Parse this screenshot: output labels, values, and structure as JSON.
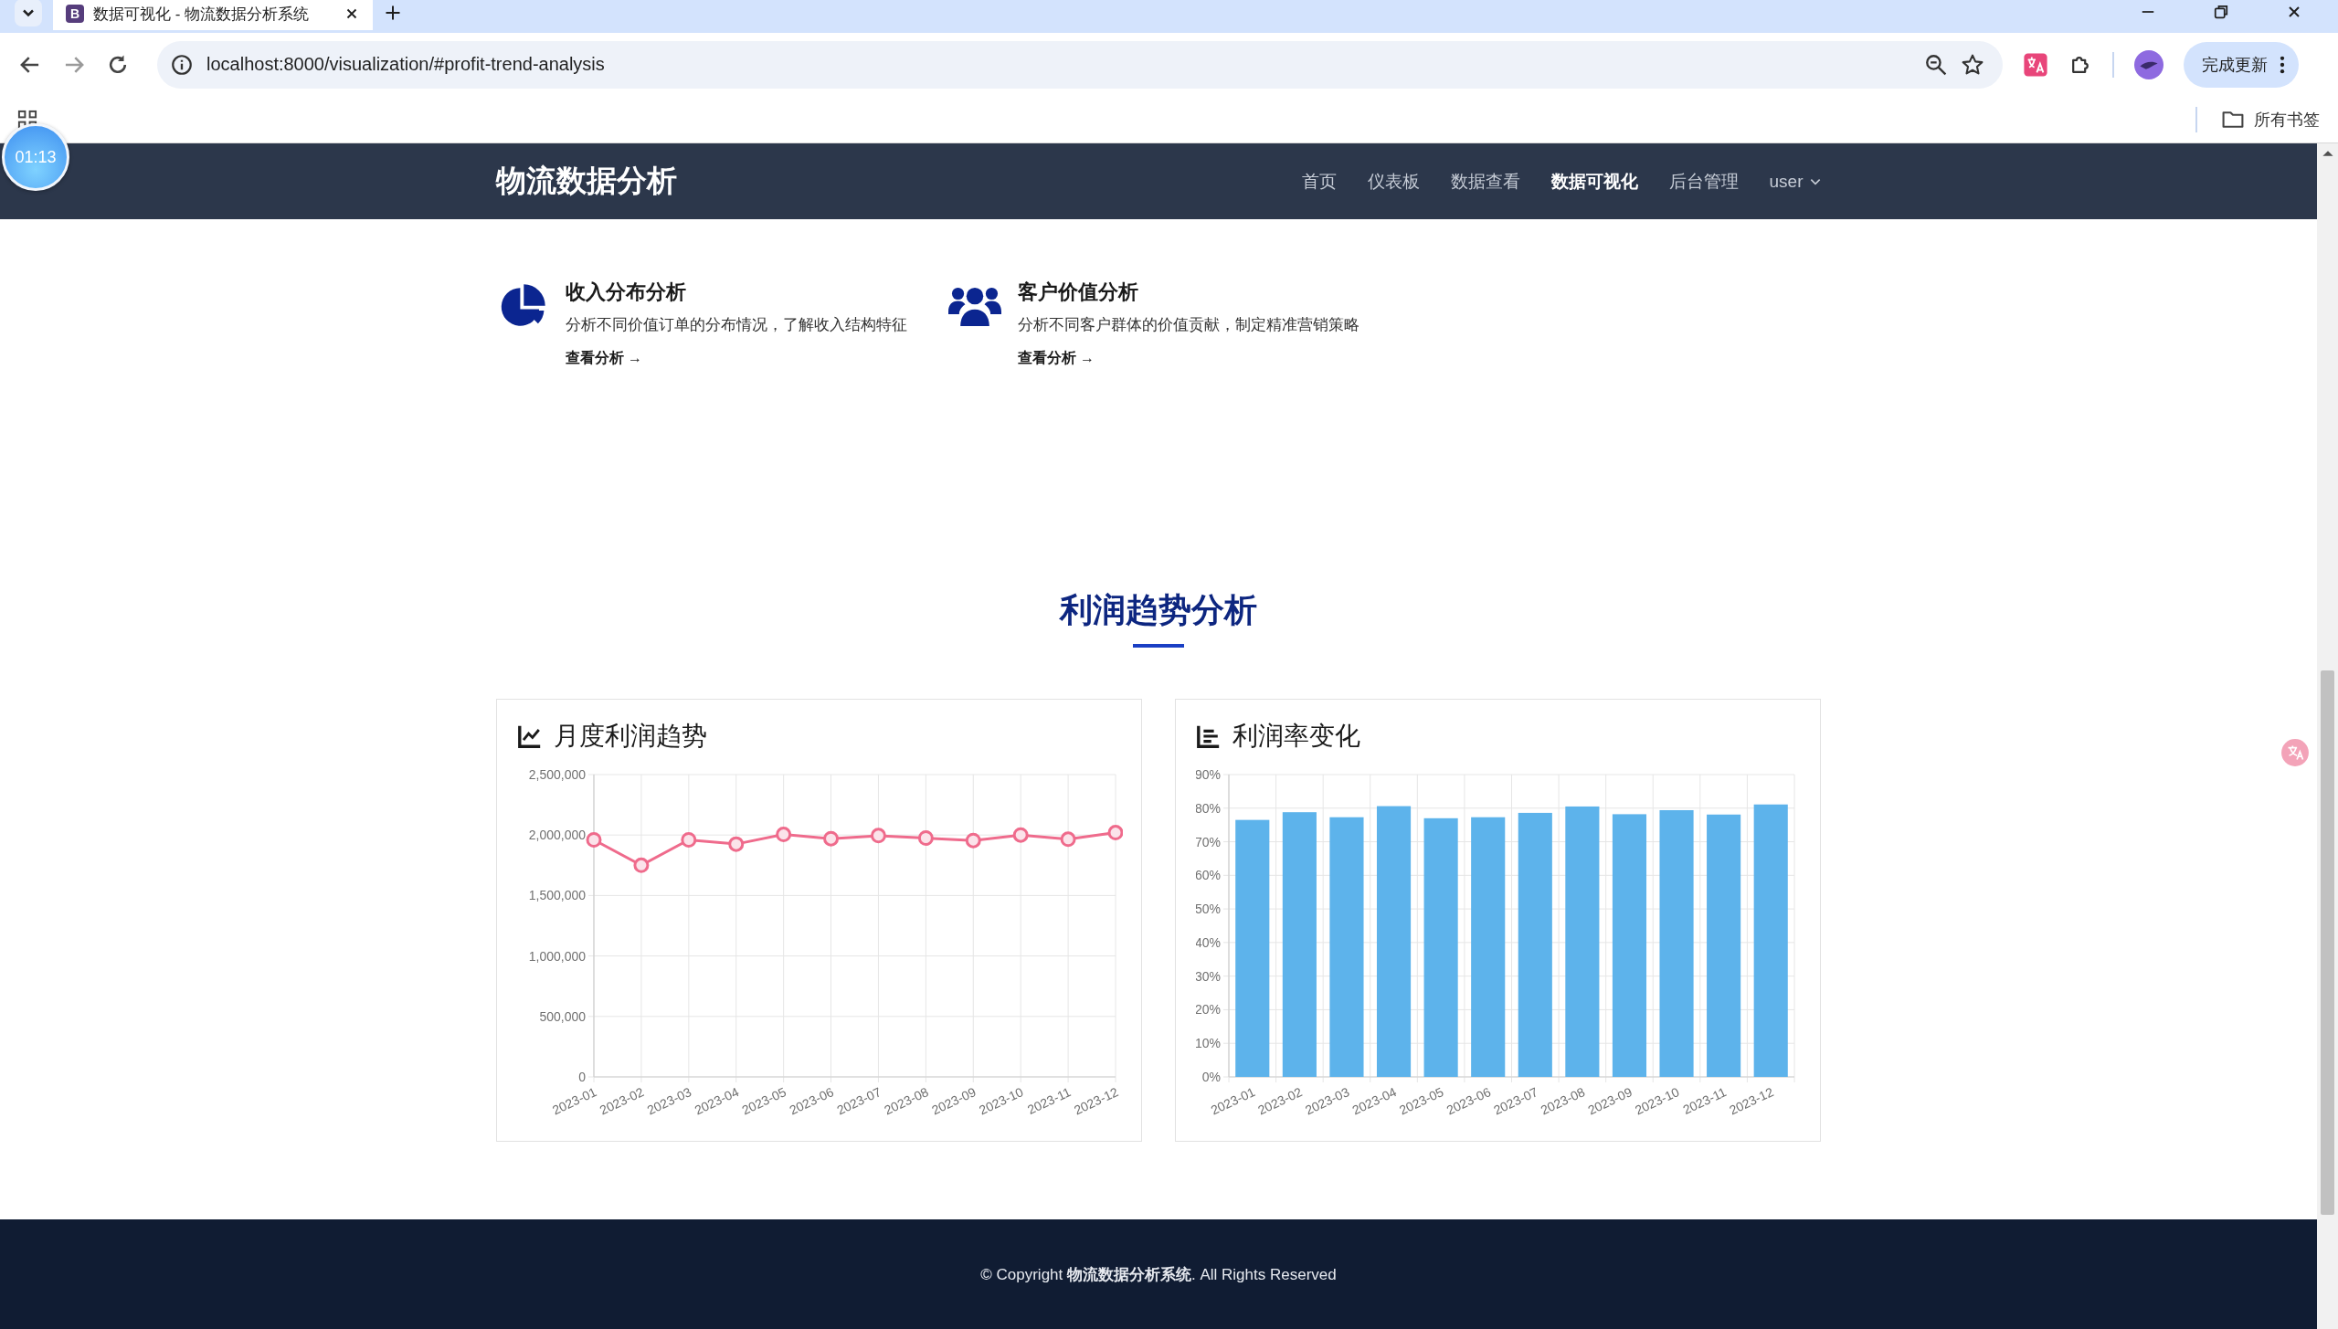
{
  "browser": {
    "tab": {
      "favicon": "B",
      "title": "数据可视化 - 物流数据分析系统",
      "selected": true
    },
    "url": "localhost:8000/visualization/#profit-trend-analysis",
    "update_button": "完成更新",
    "bookmarks_folder": "所有书签"
  },
  "timer": "01:13",
  "navbar": {
    "brand": "物流数据分析",
    "items": [
      {
        "label": "首页",
        "selected": false
      },
      {
        "label": "仪表板",
        "selected": false
      },
      {
        "label": "数据查看",
        "selected": false
      },
      {
        "label": "数据可视化",
        "selected": true
      },
      {
        "label": "后台管理",
        "selected": false
      }
    ],
    "user_menu": "user"
  },
  "analysis_cards": [
    {
      "title": "收入分布分析",
      "description": "分析不同价值订单的分布情况，了解收入结构特征",
      "link": "查看分析 →"
    },
    {
      "title": "客户价值分析",
      "description": "分析不同客户群体的价值贡献，制定精准营销策略",
      "link": "查看分析 →"
    }
  ],
  "section": {
    "title": "利润趋势分析"
  },
  "charts": [
    {
      "title": "月度利润趋势",
      "chart_data": {
        "type": "line",
        "grid": true,
        "categories": [
          "2023-01",
          "2023-02",
          "2023-03",
          "2023-04",
          "2023-05",
          "2023-06",
          "2023-07",
          "2023-08",
          "2023-09",
          "2023-10",
          "2023-11",
          "2023-12"
        ],
        "series": [
          {
            "color": "#ef6b8c",
            "marker": true,
            "values": [
              1960000,
              1750000,
              1960000,
              1925000,
              2005000,
              1970000,
              1995000,
              1975000,
              1955000,
              2000000,
              1965000,
              2020000
            ]
          }
        ],
        "ylim": [
          0,
          2500000
        ],
        "yticks": [
          {
            "value": 0,
            "label": "0"
          },
          {
            "value": 500000,
            "label": "500,000"
          },
          {
            "value": 1000000,
            "label": "1,000,000"
          },
          {
            "value": 1500000,
            "label": "1,500,000"
          },
          {
            "value": 2000000,
            "label": "2,000,000"
          },
          {
            "value": 2500000,
            "label": "2,500,000"
          }
        ]
      }
    },
    {
      "title": "利润率变化",
      "chart_data": {
        "type": "bar",
        "grid": true,
        "categories": [
          "2023-01",
          "2023-02",
          "2023-03",
          "2023-04",
          "2023-05",
          "2023-06",
          "2023-07",
          "2023-08",
          "2023-09",
          "2023-10",
          "2023-11",
          "2023-12"
        ],
        "series": [
          {
            "color": "#5db3eb",
            "values": [
              76.5,
              78.8,
              77.3,
              80.6,
              77.0,
              77.3,
              78.6,
              80.5,
              78.2,
              79.4,
              78.1,
              81.1
            ]
          }
        ],
        "ylim": [
          0,
          90
        ],
        "yticks": [
          {
            "value": 0,
            "label": "0%"
          },
          {
            "value": 10,
            "label": "10%"
          },
          {
            "value": 20,
            "label": "20%"
          },
          {
            "value": 30,
            "label": "30%"
          },
          {
            "value": 40,
            "label": "40%"
          },
          {
            "value": 50,
            "label": "50%"
          },
          {
            "value": 60,
            "label": "60%"
          },
          {
            "value": 70,
            "label": "70%"
          },
          {
            "value": 80,
            "label": "80%"
          },
          {
            "value": 90,
            "label": "90%"
          }
        ]
      }
    }
  ],
  "footer": {
    "text": "© Copyright **物流数据分析系统**. All Rights Reserved"
  }
}
